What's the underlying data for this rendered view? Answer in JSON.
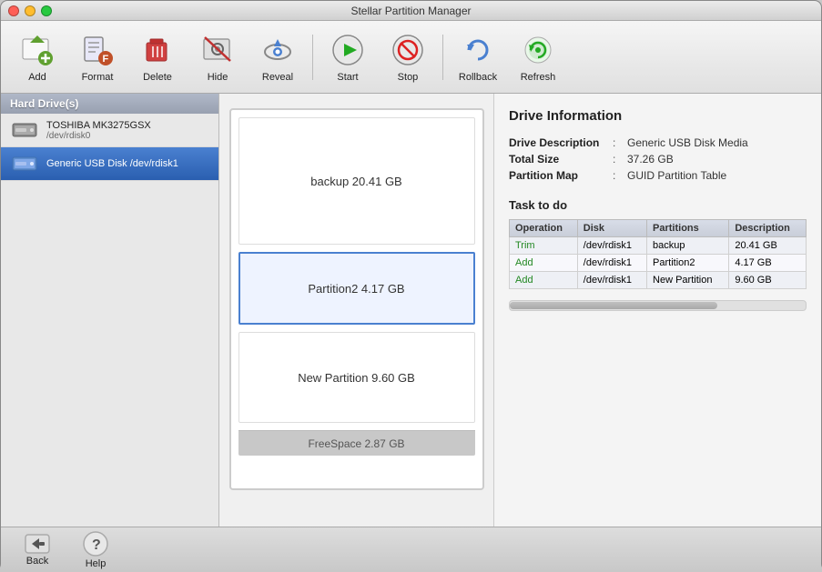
{
  "window": {
    "title": "Stellar Partition Manager"
  },
  "toolbar": {
    "buttons": [
      {
        "id": "add",
        "label": "Add"
      },
      {
        "id": "format",
        "label": "Format"
      },
      {
        "id": "delete",
        "label": "Delete"
      },
      {
        "id": "hide",
        "label": "Hide"
      },
      {
        "id": "reveal",
        "label": "Reveal"
      },
      {
        "id": "start",
        "label": "Start"
      },
      {
        "id": "stop",
        "label": "Stop"
      },
      {
        "id": "rollback",
        "label": "Rollback"
      },
      {
        "id": "refresh",
        "label": "Refresh"
      }
    ]
  },
  "sidebar": {
    "header": "Hard Drive(s)",
    "items": [
      {
        "label": "TOSHIBA MK3275GSX",
        "sub": "/dev/rdisk0",
        "selected": false
      },
      {
        "label": "Generic USB Disk /dev/rdisk1",
        "sub": "",
        "selected": true
      }
    ]
  },
  "partitions": [
    {
      "id": "backup",
      "label": "backup  20.41 GB",
      "selected": false,
      "type": "backup"
    },
    {
      "id": "partition2",
      "label": "Partition2  4.17 GB",
      "selected": true,
      "type": "p2"
    },
    {
      "id": "newpartition",
      "label": "New Partition  9.60 GB",
      "selected": false,
      "type": "newpart"
    }
  ],
  "freespace": "FreeSpace 2.87 GB",
  "driveInfo": {
    "title": "Drive Information",
    "rows": [
      {
        "label": "Drive Description",
        "value": "Generic USB Disk Media"
      },
      {
        "label": "Total Size",
        "value": "37.26 GB"
      },
      {
        "label": "Partition Map",
        "value": "GUID Partition Table"
      }
    ]
  },
  "taskTodo": {
    "title": "Task to do",
    "columns": [
      "Operation",
      "Disk",
      "Partitions",
      "Description"
    ],
    "rows": [
      {
        "op": "Trim",
        "disk": "/dev/rdisk1",
        "partition": "backup",
        "desc": "20.41 GB"
      },
      {
        "op": "Add",
        "disk": "/dev/rdisk1",
        "partition": "Partition2",
        "desc": "4.17 GB"
      },
      {
        "op": "Add",
        "disk": "/dev/rdisk1",
        "partition": "New Partition",
        "desc": "9.60 GB"
      }
    ]
  },
  "bottomBar": {
    "backLabel": "Back",
    "helpLabel": "Help"
  }
}
